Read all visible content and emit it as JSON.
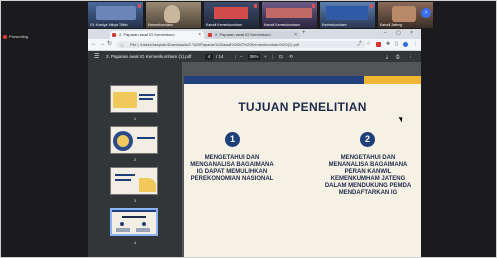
{
  "meeting": {
    "presenter_label": "Presenting",
    "participants": [
      {
        "name": "Gt. Kurniya Yahya Tribin"
      },
      {
        "name": "Kemenkumham"
      },
      {
        "name": "Kanwil Kemenkumham"
      },
      {
        "name": "Kanwil Kemenkumham"
      },
      {
        "name": "Kemenkumham"
      },
      {
        "name": "Kanwil Jateng"
      }
    ]
  },
  "browser": {
    "tabs": [
      {
        "label": "2. Paparan awal IG Kemenkum",
        "active": true
      },
      {
        "label": "2. Paparan awal IG Kemenkum",
        "active": false
      }
    ],
    "address": "File | /Users/asep/ab/Downloads/2.%20Paparan%20awal%20IG%20Kemenkumham%20(1).pdf"
  },
  "pdf": {
    "file_name": "2. Paparan awal IG Kemenkumham (1).pdf",
    "current_page": "4",
    "total_pages": "/ 14",
    "zoom": "36%",
    "thumb_numbers": [
      "1",
      "2",
      "3",
      "4"
    ],
    "slide": {
      "title": "TUJUAN PENELITIAN",
      "items": [
        {
          "number": "1",
          "text": "MENGETAHUI DAN MENGANALISA BAGAIMANA IG DAPAT MEMULIHKAN PEREKONOMIAN NASIONAL"
        },
        {
          "number": "2",
          "text": "MENGETAHUI DAN MENANALISA BAGAIMANA PERAN KANWIL KEMENKUMHAM JATENG DALAM MENDUKUNG PEMDA MENDAFTARKAN IG"
        }
      ]
    }
  },
  "colors": {
    "slide_navy": "#1f3f7a",
    "slide_gold": "#f2b635",
    "slide_bg": "#f6f1e5",
    "pdf_toolbar": "#323639"
  }
}
